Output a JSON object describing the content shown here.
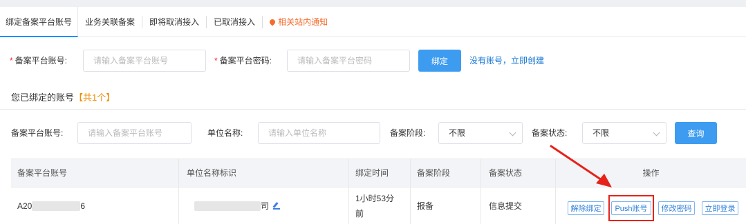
{
  "tabs": [
    {
      "label": "绑定备案平台账号",
      "active": true
    },
    {
      "label": "业务关联备案",
      "active": false
    },
    {
      "label": "即将取消接入",
      "active": false
    },
    {
      "label": "已取消接入",
      "active": false
    },
    {
      "label": "相关站内通知",
      "active": false
    }
  ],
  "bind_form": {
    "account_label": "备案平台账号:",
    "account_placeholder": "请输入备案平台账号",
    "password_label": "备案平台密码:",
    "password_placeholder": "请输入备案平台密码",
    "bind_button": "绑定",
    "create_link": "没有账号，立即创建",
    "required_mark": "*"
  },
  "bound_section": {
    "title": "您已绑定的账号",
    "count_text": "【共1个】"
  },
  "filters": {
    "account_label": "备案平台账号:",
    "account_placeholder": "请输入备案平台账号",
    "unit_label": "单位名称:",
    "unit_placeholder": "请输入单位名称",
    "stage_label": "备案阶段:",
    "stage_value": "不限",
    "status_label": "备案状态:",
    "status_value": "不限",
    "query_button": "查询"
  },
  "table": {
    "headers": [
      "备案平台账号",
      "单位名称标识",
      "绑定时间",
      "备案阶段",
      "备案状态",
      "操作"
    ],
    "rows": [
      {
        "account_prefix": "A20",
        "account_suffix": "6",
        "unit_suffix": "司",
        "bind_time_line1": "1小时53分",
        "bind_time_line2": "前",
        "stage": "报备",
        "status": "信息提交",
        "actions": [
          "解除绑定",
          "Push账号",
          "修改密码",
          "立即登录"
        ]
      }
    ]
  },
  "colors": {
    "primary": "#3d9cf0",
    "link": "#1677d6",
    "accent_orange": "#f08c00",
    "annotation_red": "#e5231a"
  }
}
